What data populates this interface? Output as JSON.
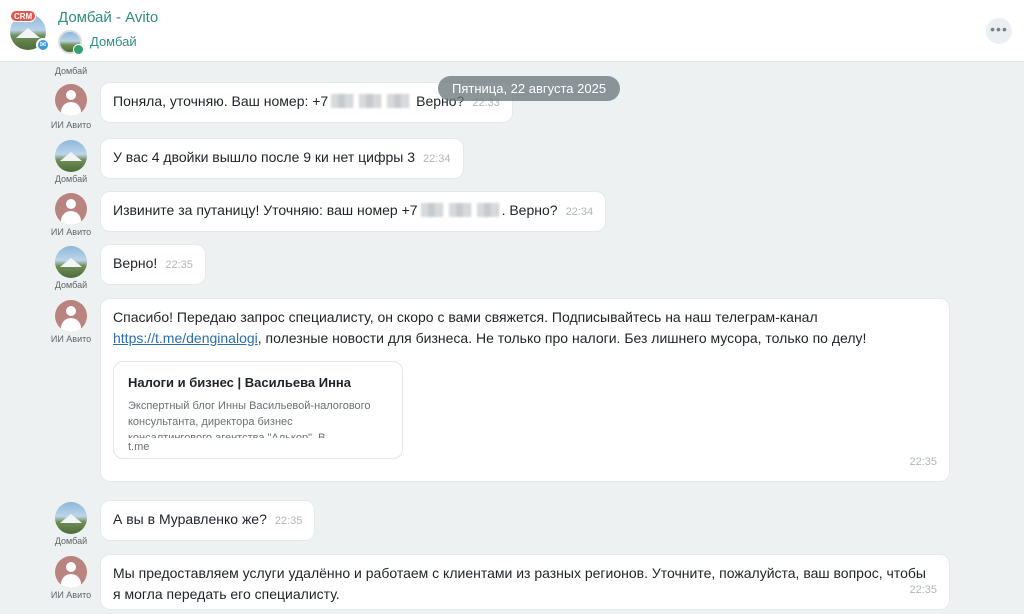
{
  "header": {
    "badge": "CRM",
    "title": "Домбай - Avito",
    "subtitle": "Домбай",
    "more_label": "•••"
  },
  "date_divider": "Пятница, 22 августа 2025",
  "top_sender": "Домбай",
  "messages": [
    {
      "sender": "ИИ Авито",
      "text_a": "Поняла, уточняю. Ваш номер: +7",
      "text_b": "Верно?",
      "time": "22:33"
    },
    {
      "sender": "Домбай",
      "text": "У вас 4 двойки вышло после 9 ки нет цифры 3",
      "time": "22:34"
    },
    {
      "sender": "ИИ Авито",
      "text_a": "Извините за путаницу! Уточняю: ваш номер +7",
      "text_b": ". Верно?",
      "time": "22:34"
    },
    {
      "sender": "Домбай",
      "text": "Верно!",
      "time": "22:35"
    },
    {
      "sender": "ИИ Авито",
      "text_a": "Спасибо! Передаю запрос специалисту, он скоро с вами свяжется. Подписывайтесь на наш телеграм-канал",
      "link": "https://t.me/denginalogi",
      "text_b": ", полезные новости для бизнеса. Не только про налоги. Без лишнего мусора, только по делу!",
      "preview": {
        "title": "Налоги и бизнес | Васильева Инна",
        "desc": "Экспертный блог Инны Васильевой-налогового консультанта, директора бизнес",
        "desc2": "консалтингового агентства \"Алькор\". В",
        "domain": "t.me"
      },
      "time": "22:35"
    },
    {
      "sender": "Домбай",
      "text": "А вы в Муравленко же?",
      "time": "22:35"
    },
    {
      "sender": "ИИ Авито",
      "text": "Мы предоставляем услуги удалённо и работаем с клиентами из разных регионов. Уточните, пожалуйста, ваш вопрос, чтобы я могла передать его специалисту.",
      "time": "22:35"
    }
  ]
}
